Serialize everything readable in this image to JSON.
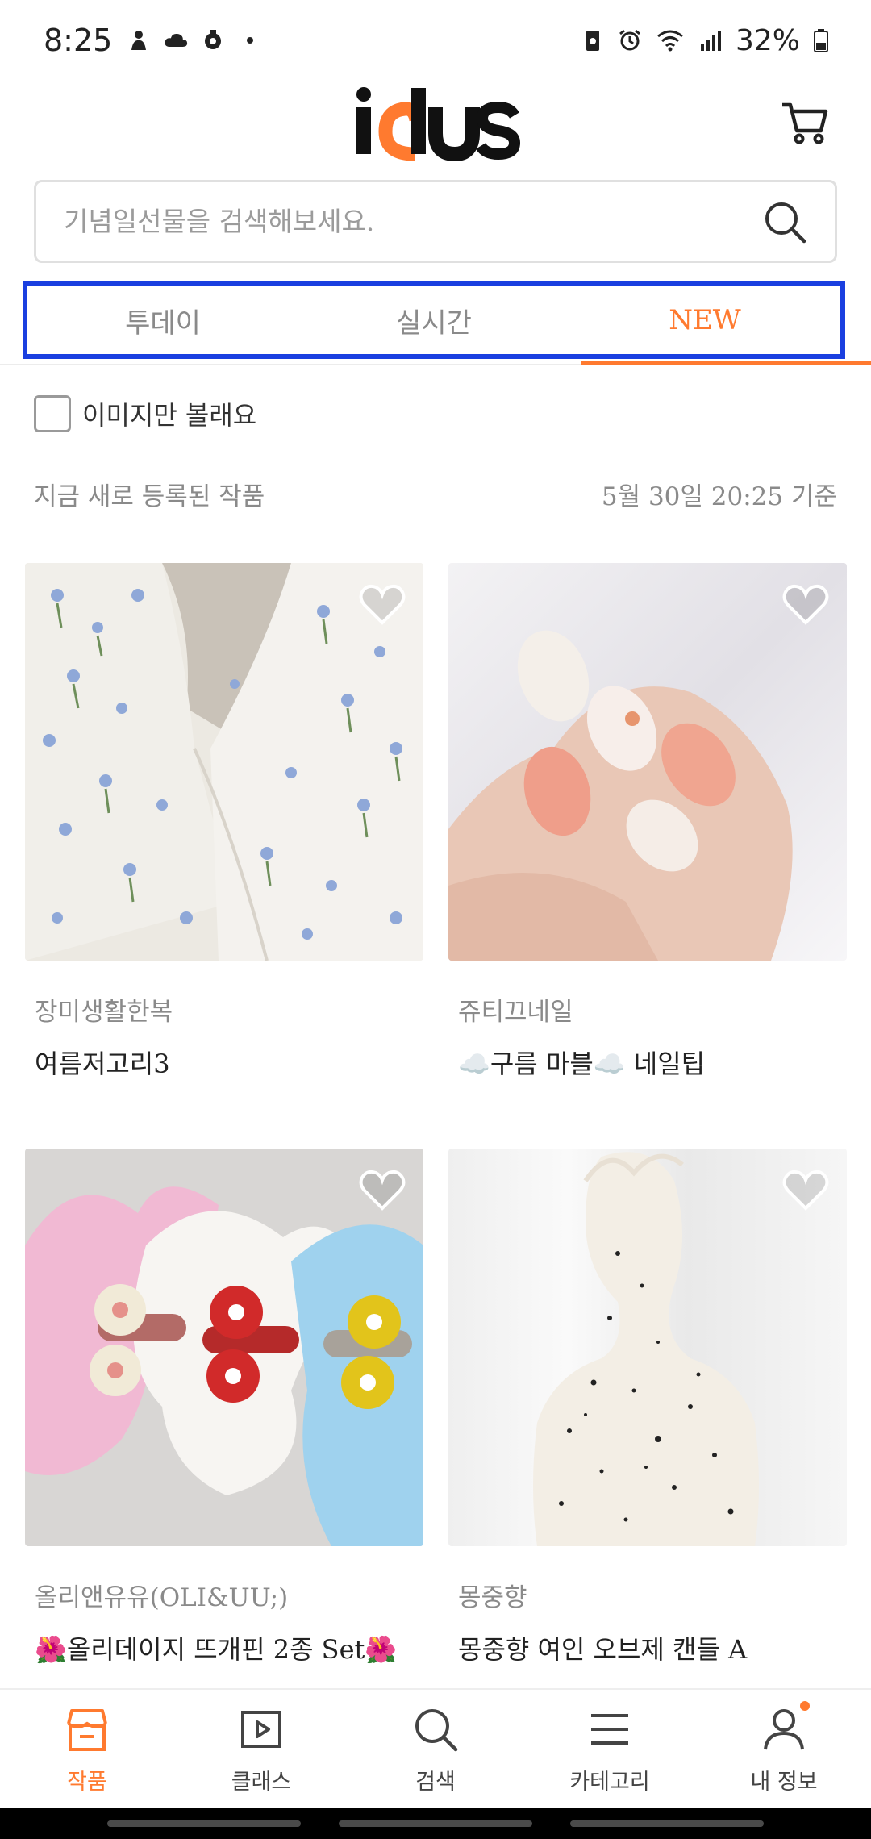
{
  "status_bar": {
    "time": "8:25",
    "battery": "32%",
    "left_icons": [
      "person-icon",
      "cloud-icon",
      "location-icon",
      "dot-icon"
    ],
    "right_icons": [
      "battery-saver-icon",
      "alarm-icon",
      "wifi-icon",
      "signal-icon",
      "battery-icon"
    ]
  },
  "header": {
    "logo_text": "idus",
    "brand_color": "#ff7a2f"
  },
  "search": {
    "placeholder": "기념일선물을 검색해보세요."
  },
  "tabs": [
    {
      "label": "투데이",
      "active": false
    },
    {
      "label": "실시간",
      "active": false
    },
    {
      "label": "NEW",
      "active": true
    }
  ],
  "filter": {
    "label": "이미지만 볼래요",
    "checked": false
  },
  "section": {
    "title": "지금 새로 등록된 작품",
    "timestamp": "5월 30일 20:25 기준"
  },
  "products": [
    {
      "seller": "장미생활한복",
      "title": "여름저고리3"
    },
    {
      "seller": "쥬티끄네일",
      "title": "☁️구름 마블☁️ 네일팁"
    },
    {
      "seller": "올리앤유유(OLI&UU;)",
      "title": "🌺올리데이지 뜨개핀 2종 Set🌺"
    },
    {
      "seller": "몽중향",
      "title": "몽중향 여인 오브제 캔들 A"
    }
  ],
  "bottom_nav": [
    {
      "label": "작품",
      "icon": "shop-icon",
      "active": true
    },
    {
      "label": "클래스",
      "icon": "play-icon",
      "active": false
    },
    {
      "label": "검색",
      "icon": "search-icon",
      "active": false
    },
    {
      "label": "카테고리",
      "icon": "menu-icon",
      "active": false
    },
    {
      "label": "내 정보",
      "icon": "user-icon",
      "active": false,
      "badge": true
    }
  ],
  "colors": {
    "accent": "#ff7a2f",
    "highlight_frame": "#1a3fe0"
  }
}
